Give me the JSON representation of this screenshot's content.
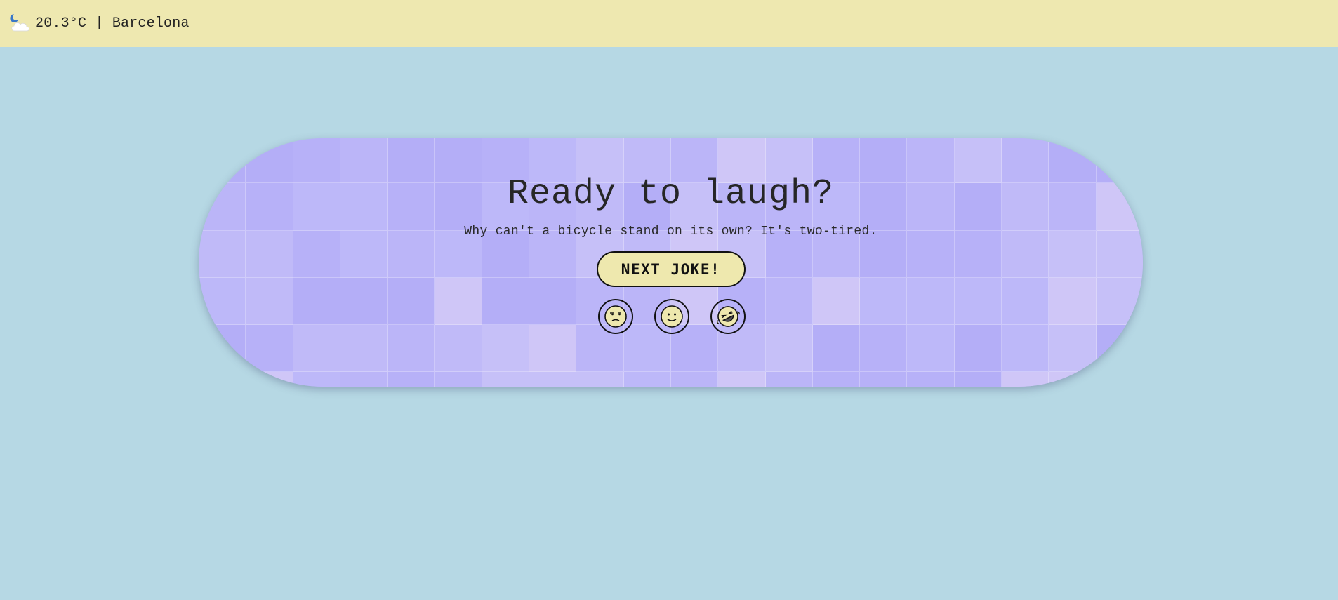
{
  "header": {
    "weather_icon": "moon-cloud-icon",
    "weather_text": "20.3°C | Barcelona"
  },
  "card": {
    "title": "Ready to laugh?",
    "joke": "Why can't a bicycle stand on its own? It's two-tired.",
    "next_button_label": "NEXT JOKE!",
    "reactions": [
      {
        "icon": "unamused-face-icon"
      },
      {
        "icon": "slight-smile-face-icon"
      },
      {
        "icon": "rolling-laughing-face-icon"
      }
    ]
  },
  "colors": {
    "page_background": "#b6d8e4",
    "topbar_background": "#eee8b0",
    "card_background": "#b9b4f8",
    "button_background": "#eee8ae",
    "emoji_face": "#eee8ae"
  }
}
